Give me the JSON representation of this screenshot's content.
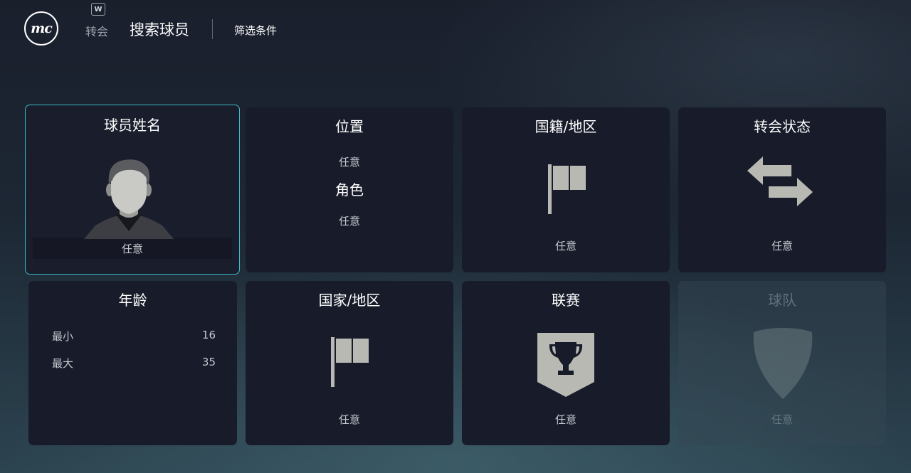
{
  "header": {
    "logo_text": "mc",
    "key_hint": "W",
    "breadcrumb_parent": "转会",
    "title": "搜索球员",
    "section": "筛选条件"
  },
  "cards": {
    "player_name": {
      "title": "球员姓名",
      "value": "任意",
      "icon": "player-silhouette-icon"
    },
    "position": {
      "title": "位置",
      "value": "任意",
      "role_title": "角色",
      "role_value": "任意"
    },
    "nationality": {
      "title": "国籍/地区",
      "value": "任意",
      "icon": "flag-icon"
    },
    "transfer_status": {
      "title": "转会状态",
      "value": "任意",
      "icon": "transfer-arrows-icon"
    },
    "age": {
      "title": "年龄",
      "min_label": "最小",
      "min_value": "16",
      "max_label": "最大",
      "max_value": "35"
    },
    "country": {
      "title": "国家/地区",
      "value": "任意",
      "icon": "flag-icon"
    },
    "league": {
      "title": "联赛",
      "value": "任意",
      "icon": "trophy-shield-icon"
    },
    "team": {
      "title": "球队",
      "value": "任意",
      "icon": "club-crest-icon",
      "disabled": true
    }
  },
  "colors": {
    "selected_border": "#3fb8c4",
    "card_bg": "#181c2a",
    "icon_gray": "#b9b9b4"
  }
}
